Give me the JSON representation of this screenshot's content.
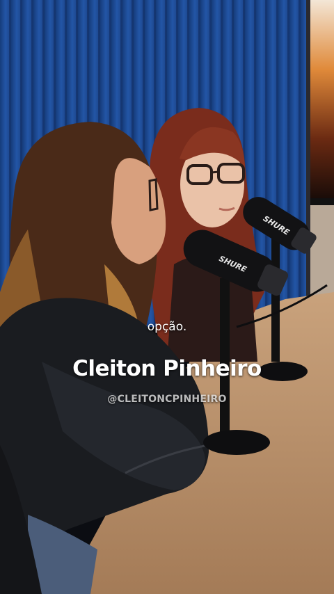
{
  "subtitles": {
    "caption": "opção.",
    "speaker_name": "Cleiton Pinheiro",
    "speaker_handle": "@CLEITONCPINHEIRO"
  },
  "microphones": {
    "brand_front": "SHURE",
    "brand_back": "SHURE"
  },
  "colors": {
    "wall": "#1f4f9e",
    "desk": "#b8906a",
    "jacket": "#1a1c20",
    "hair_left": "#4a2a18",
    "hair_right": "#7a2c1c"
  }
}
